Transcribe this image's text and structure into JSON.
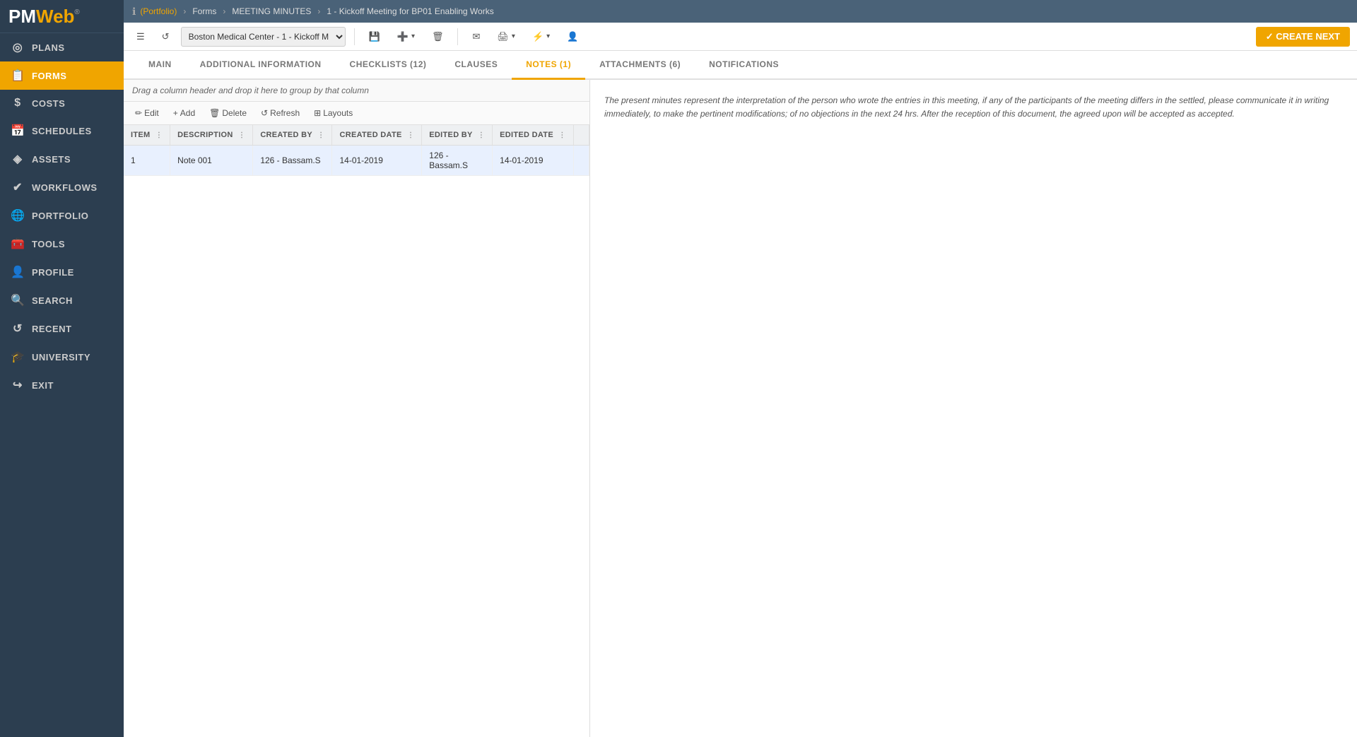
{
  "app": {
    "name": "PMWeb",
    "trademark": "®"
  },
  "topbar": {
    "info_icon": "ℹ",
    "breadcrumb": [
      {
        "label": "(Portfolio)",
        "link": true
      },
      {
        "label": "Forms",
        "link": false
      },
      {
        "label": "MEETING MINUTES",
        "link": false
      },
      {
        "label": "1 - Kickoff Meeting for BP01 Enabling Works",
        "link": false
      }
    ]
  },
  "toolbar": {
    "list_icon": "☰",
    "undo_icon": "↺",
    "dropdown_value": "Boston Medical Center - 1 - Kickoff M",
    "save_icon": "💾",
    "add_icon": "➕",
    "delete_icon": "🗑",
    "email_icon": "✉",
    "print_icon": "🖨",
    "lightning_icon": "⚡",
    "user_icon": "👤",
    "create_next_label": "✓ CREATE NEXT"
  },
  "tabs": [
    {
      "id": "main",
      "label": "MAIN",
      "active": false
    },
    {
      "id": "additional",
      "label": "ADDITIONAL INFORMATION",
      "active": false
    },
    {
      "id": "checklists",
      "label": "CHECKLISTS (12)",
      "active": false
    },
    {
      "id": "clauses",
      "label": "CLAUSES",
      "active": false
    },
    {
      "id": "notes",
      "label": "NOTES (1)",
      "active": true
    },
    {
      "id": "attachments",
      "label": "ATTACHMENTS (6)",
      "active": false
    },
    {
      "id": "notifications",
      "label": "NOTIFICATIONS",
      "active": false
    }
  ],
  "grid": {
    "drag_hint": "Drag a column header and drop it here to group by that column",
    "toolbar": {
      "edit_label": "Edit",
      "add_label": "Add",
      "delete_label": "Delete",
      "refresh_label": "Refresh",
      "layouts_label": "Layouts"
    },
    "columns": [
      {
        "id": "item",
        "label": "ITEM"
      },
      {
        "id": "description",
        "label": "DESCRIPTION"
      },
      {
        "id": "created_by",
        "label": "CREATED BY"
      },
      {
        "id": "created_date",
        "label": "CREATED DATE"
      },
      {
        "id": "edited_by",
        "label": "EDITED BY"
      },
      {
        "id": "edited_date",
        "label": "EDITED DATE"
      }
    ],
    "rows": [
      {
        "item": "1",
        "description": "Note 001",
        "created_by": "126 - Bassam.S",
        "created_date": "14-01-2019",
        "edited_by": "126 - Bassam.S",
        "edited_date": "14-01-2019"
      }
    ]
  },
  "notes_panel": {
    "text": "The present minutes represent the interpretation of the person who wrote the entries in this meeting, if any of the participants of the meeting differs in the settled, please communicate it in writing immediately, to make the pertinent modifications; of no objections in the next 24 hrs. After the reception of this document, the agreed upon will be accepted as accepted."
  },
  "sidebar": {
    "items": [
      {
        "id": "plans",
        "label": "PLANS",
        "icon": "◎",
        "active": false
      },
      {
        "id": "forms",
        "label": "FORMS",
        "icon": "📋",
        "active": true
      },
      {
        "id": "costs",
        "label": "COSTS",
        "icon": "$",
        "active": false
      },
      {
        "id": "schedules",
        "label": "SCHEDULES",
        "icon": "📅",
        "active": false
      },
      {
        "id": "assets",
        "label": "ASSETS",
        "icon": "◈",
        "active": false
      },
      {
        "id": "workflows",
        "label": "WORKFLOWS",
        "icon": "✔",
        "active": false
      },
      {
        "id": "portfolio",
        "label": "PORTFOLIO",
        "icon": "🌐",
        "active": false
      },
      {
        "id": "tools",
        "label": "TOOLS",
        "icon": "🧰",
        "active": false
      },
      {
        "id": "profile",
        "label": "PROFILE",
        "icon": "👤",
        "active": false
      },
      {
        "id": "search",
        "label": "SEARCH",
        "icon": "🔍",
        "active": false
      },
      {
        "id": "recent",
        "label": "RECENT",
        "icon": "↺",
        "active": false
      },
      {
        "id": "university",
        "label": "UNIVERSITY",
        "icon": "🎓",
        "active": false
      },
      {
        "id": "exit",
        "label": "EXIT",
        "icon": "↪",
        "active": false
      }
    ]
  }
}
